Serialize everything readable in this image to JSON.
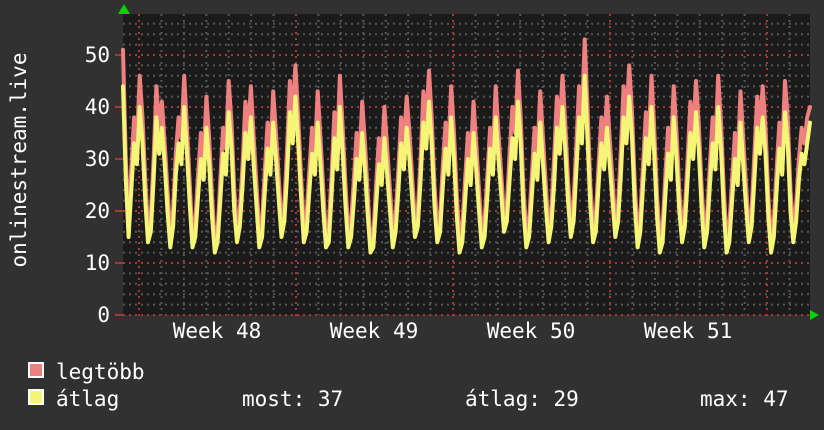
{
  "left_title": "onlinestream.live",
  "legend": {
    "series": [
      {
        "label": "legtöbb",
        "color": "#ef8080"
      },
      {
        "label": "átlag",
        "color": "#f5f578"
      }
    ]
  },
  "stats": [
    {
      "text": "most: 37"
    },
    {
      "text": "átlag: 29"
    },
    {
      "text": "max: 47"
    }
  ],
  "chart_data": {
    "type": "line",
    "title": "onlinestream.live",
    "xlabel": "",
    "ylabel": "onlinestream.live",
    "ylim": [
      0,
      58
    ],
    "yticks": [
      0,
      10,
      20,
      30,
      40,
      50
    ],
    "xticks": [
      {
        "label": "Week 48"
      },
      {
        "label": "Week 49"
      },
      {
        "label": "Week 50"
      },
      {
        "label": "Week 51"
      }
    ],
    "grid": "dotted, minor every 2 units / 1 day, major red every 10 units / 1 week",
    "legend_position": "bottom-left",
    "colors": {
      "canvas": "#1b1b1b",
      "background": "#313131",
      "grid_minor": "#565656",
      "grid_major": "#a83838",
      "arrow": "#00d400",
      "text": "#ffffff"
    },
    "samples_per_day": 8,
    "series": [
      {
        "name": "legtöbb",
        "color": "#ef8080",
        "values": [
          51,
          30,
          18,
          28,
          38,
          33,
          46,
          38,
          26,
          17,
          19,
          30,
          44,
          36,
          41,
          33,
          24,
          16,
          20,
          31,
          38,
          34,
          46,
          36,
          25,
          15,
          18,
          27,
          35,
          30,
          42,
          34,
          23,
          14,
          16,
          26,
          36,
          32,
          45,
          37,
          24,
          17,
          20,
          29,
          41,
          35,
          44,
          34,
          25,
          16,
          18,
          28,
          37,
          31,
          43,
          35,
          26,
          18,
          21,
          32,
          45,
          38,
          48,
          38,
          27,
          17,
          19,
          28,
          36,
          31,
          43,
          34,
          24,
          15,
          17,
          27,
          39,
          33,
          46,
          36,
          25,
          16,
          18,
          26,
          35,
          30,
          41,
          33,
          23,
          14,
          15,
          25,
          34,
          29,
          40,
          32,
          24,
          16,
          19,
          28,
          38,
          33,
          42,
          35,
          26,
          18,
          20,
          30,
          43,
          37,
          47,
          38,
          25,
          17,
          19,
          29,
          37,
          32,
          44,
          35,
          23,
          15,
          17,
          26,
          35,
          30,
          41,
          33,
          24,
          16,
          18,
          27,
          36,
          31,
          44,
          35,
          27,
          19,
          21,
          31,
          40,
          35,
          47,
          38,
          24,
          16,
          18,
          27,
          36,
          31,
          43,
          34,
          25,
          17,
          20,
          30,
          42,
          36,
          46,
          37,
          26,
          18,
          22,
          33,
          44,
          38,
          53,
          40,
          25,
          17,
          19,
          29,
          38,
          33,
          42,
          34,
          26,
          18,
          21,
          32,
          44,
          38,
          48,
          39,
          25,
          16,
          19,
          29,
          39,
          34,
          46,
          36,
          23,
          15,
          17,
          27,
          36,
          31,
          44,
          35,
          24,
          17,
          20,
          30,
          41,
          35,
          45,
          37,
          25,
          16,
          19,
          29,
          38,
          33,
          46,
          37,
          24,
          15,
          17,
          26,
          35,
          30,
          43,
          34,
          25,
          17,
          20,
          31,
          42,
          36,
          44,
          36,
          23,
          15,
          18,
          28,
          37,
          32,
          45,
          38,
          24,
          17,
          21,
          30,
          36,
          33,
          38,
          40
        ]
      },
      {
        "name": "átlag",
        "color": "#f5f578",
        "values": [
          44,
          26,
          15,
          24,
          33,
          29,
          40,
          33,
          22,
          14,
          16,
          26,
          38,
          31,
          36,
          29,
          20,
          13,
          17,
          27,
          33,
          29,
          40,
          31,
          21,
          13,
          15,
          23,
          30,
          26,
          36,
          29,
          19,
          12,
          14,
          22,
          31,
          27,
          39,
          32,
          20,
          14,
          17,
          25,
          35,
          30,
          38,
          29,
          21,
          13,
          15,
          24,
          32,
          27,
          37,
          30,
          22,
          15,
          18,
          27,
          39,
          33,
          42,
          33,
          23,
          14,
          16,
          24,
          31,
          27,
          37,
          29,
          20,
          13,
          14,
          23,
          34,
          28,
          40,
          31,
          21,
          13,
          15,
          22,
          30,
          26,
          35,
          28,
          19,
          12,
          13,
          21,
          29,
          25,
          34,
          27,
          20,
          13,
          16,
          24,
          33,
          28,
          36,
          30,
          22,
          15,
          17,
          26,
          37,
          32,
          41,
          33,
          21,
          14,
          16,
          25,
          32,
          27,
          38,
          30,
          19,
          12,
          14,
          22,
          30,
          25,
          35,
          28,
          20,
          13,
          15,
          23,
          32,
          27,
          38,
          30,
          23,
          16,
          18,
          26,
          34,
          30,
          41,
          33,
          20,
          13,
          15,
          23,
          31,
          26,
          37,
          29,
          21,
          14,
          17,
          25,
          36,
          31,
          40,
          32,
          22,
          15,
          18,
          28,
          38,
          33,
          46,
          34,
          21,
          14,
          16,
          25,
          33,
          28,
          36,
          29,
          22,
          15,
          18,
          27,
          38,
          33,
          42,
          34,
          21,
          13,
          16,
          25,
          34,
          29,
          40,
          31,
          19,
          12,
          14,
          23,
          31,
          26,
          38,
          30,
          20,
          14,
          17,
          26,
          35,
          30,
          39,
          32,
          21,
          13,
          16,
          25,
          33,
          28,
          40,
          32,
          20,
          12,
          14,
          22,
          30,
          25,
          37,
          29,
          21,
          14,
          17,
          26,
          36,
          31,
          38,
          31,
          19,
          12,
          15,
          24,
          32,
          27,
          39,
          33,
          20,
          14,
          18,
          26,
          31,
          29,
          33,
          37
        ]
      }
    ]
  }
}
